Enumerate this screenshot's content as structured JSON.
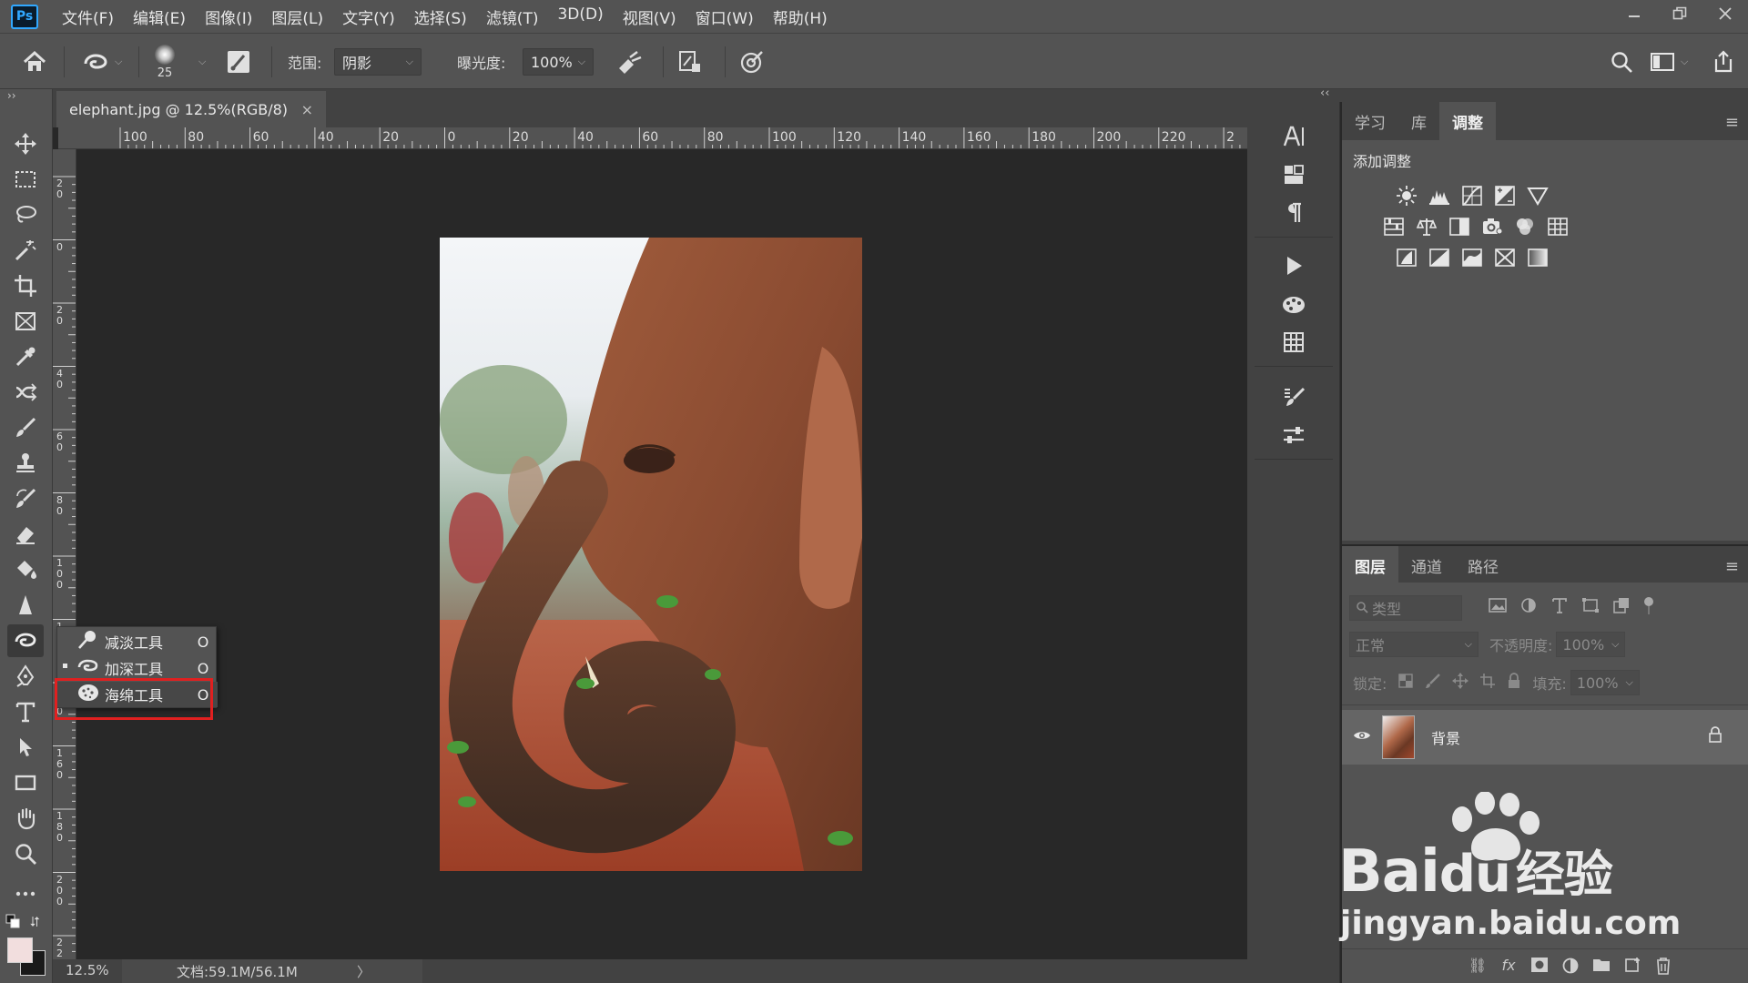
{
  "app": {
    "logo_text": "Ps"
  },
  "menu": [
    "文件(F)",
    "编辑(E)",
    "图像(I)",
    "图层(L)",
    "文字(Y)",
    "选择(S)",
    "滤镜(T)",
    "3D(D)",
    "视图(V)",
    "窗口(W)",
    "帮助(H)"
  ],
  "options": {
    "brush_size": "25",
    "range_label": "范围:",
    "range_value": "阴影",
    "exposure_label": "曝光度:",
    "exposure_value": "100%"
  },
  "document": {
    "tab_title": "elephant.jpg @ 12.5%(RGB/8)",
    "tab_close": "×",
    "ruler_top": [
      "100",
      "80",
      "60",
      "40",
      "20",
      "0",
      "20",
      "40",
      "60",
      "80",
      "100",
      "120",
      "140",
      "160",
      "180",
      "200",
      "220",
      "2"
    ],
    "ruler_left": [
      "2\n0",
      "0",
      "2\n0",
      "4\n0",
      "6\n0",
      "8\n0",
      "1\n0\n0",
      "1\n2\n0",
      "1\n4\n0",
      "1\n6\n0",
      "1\n8\n0",
      "2\n0\n0",
      "2\n2\n0"
    ]
  },
  "status": {
    "zoom": "12.5%",
    "doc_info": "文档:59.1M/56.1M",
    "arrow": "〉"
  },
  "flyout": [
    {
      "label": "减淡工具",
      "key": "O",
      "icon": "dodge-icon",
      "active": false
    },
    {
      "label": "加深工具",
      "key": "O",
      "icon": "burn-icon",
      "active": true
    },
    {
      "label": "海绵工具",
      "key": "O",
      "icon": "sponge-icon",
      "active": false
    }
  ],
  "right_panels": {
    "collapse": "‹‹",
    "adjust_tabs": [
      "学习",
      "库",
      "调整"
    ],
    "adjust_active": "调整",
    "adjust_title": "添加调整",
    "layers_tabs": [
      "图层",
      "通道",
      "路径"
    ],
    "layers_active": "图层",
    "filter_placeholder": "类型",
    "blend_mode": "正常",
    "opacity_label": "不透明度:",
    "opacity_value": "100%",
    "lock_label": "锁定:",
    "fill_label": "填充:",
    "fill_value": "100%",
    "layer_name": "背景"
  },
  "watermark": {
    "brand": "Bai",
    "brand2": "du",
    "cn": "经验",
    "url": "jingyan.baidu.com"
  },
  "colors": {
    "panel": "#535353",
    "dark": "#424242",
    "canvas": "#282828",
    "highlight": "#e02020",
    "ps_blue": "#31a8ff"
  }
}
